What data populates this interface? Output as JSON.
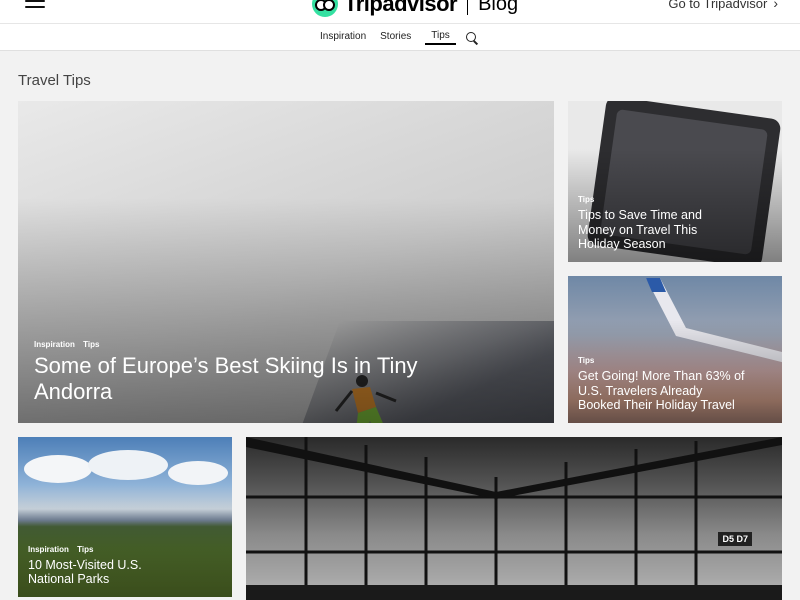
{
  "header": {
    "brand": "Tripadvisor",
    "section": "Blog",
    "goto_label": "Go to Tripadvisor"
  },
  "subnav": {
    "items": [
      {
        "label": "Inspiration"
      },
      {
        "label": "Stories"
      },
      {
        "label": "Tips"
      }
    ],
    "active": "Tips"
  },
  "page": {
    "title": "Travel Tips"
  },
  "cards": [
    {
      "tags": [
        "Inspiration",
        "Tips"
      ],
      "title": "Some of Europe’s Best Skiing Is in Tiny Andorra"
    },
    {
      "tags": [
        "Tips"
      ],
      "title": "Tips to Save Time and Money on Travel This Holiday Season"
    },
    {
      "tags": [
        "Tips"
      ],
      "title": "Get Going! More Than 63% of U.S. Travelers Already Booked Their Holiday Travel"
    },
    {
      "tags": [
        "Inspiration",
        "Tips"
      ],
      "title": "10 Most-Visited U.S. National Parks"
    },
    {
      "tags": [],
      "title": "",
      "image_text": "D5 D7"
    }
  ],
  "colors": {
    "brand_green": "#34e0a1",
    "background": "#f2f2f2"
  },
  "icons": [
    "hamburger-menu-icon",
    "tripadvisor-owl-icon",
    "chevron-right-icon",
    "search-icon"
  ]
}
